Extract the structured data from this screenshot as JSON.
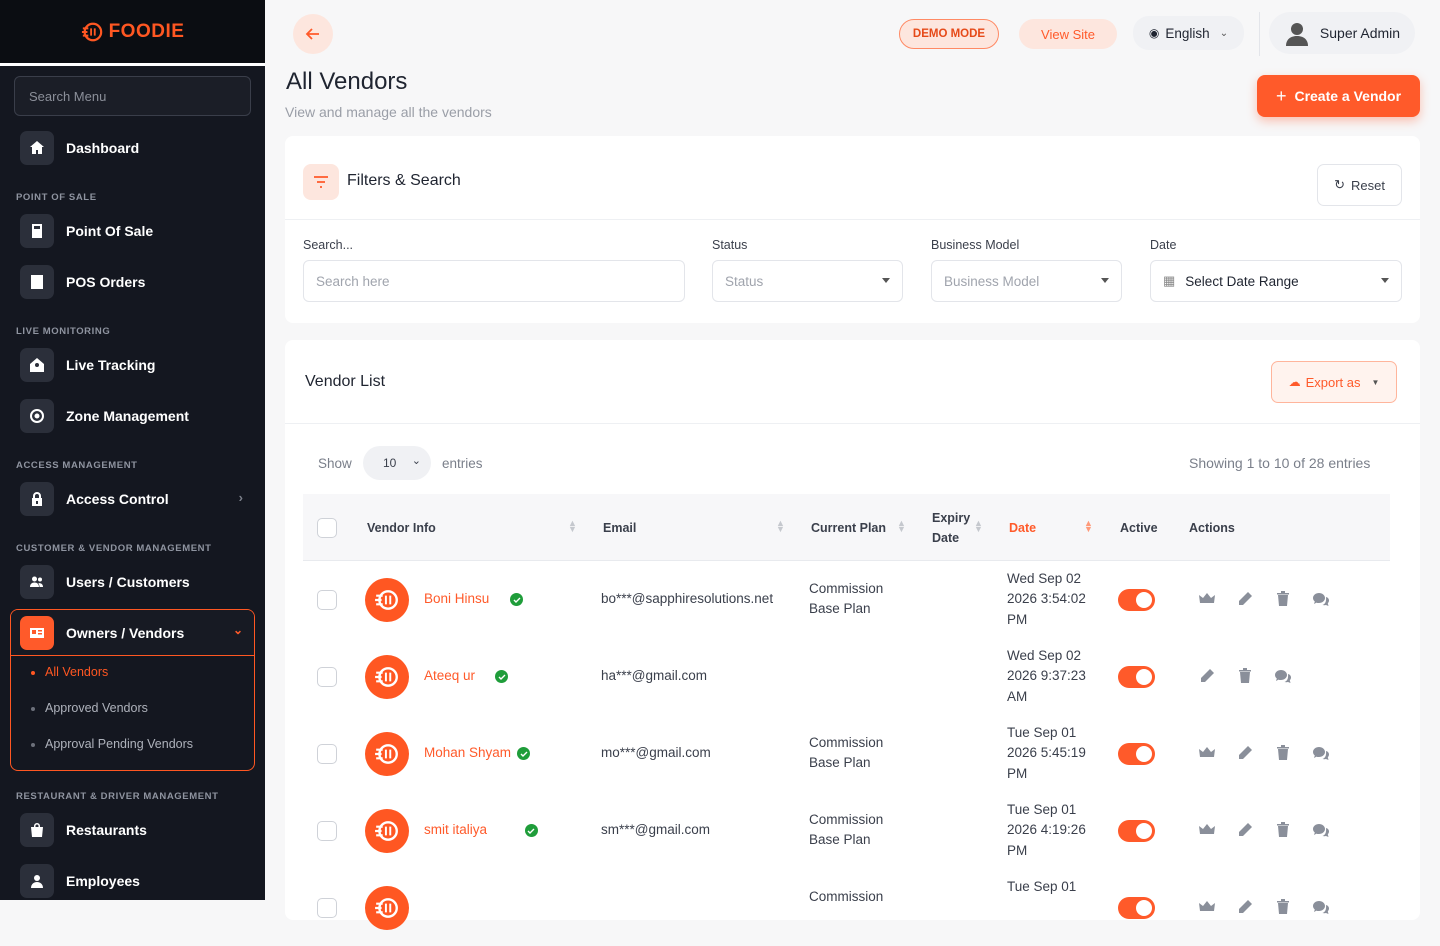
{
  "brand": {
    "name": "FOODIE",
    "accent": "#ff5722"
  },
  "sidebar": {
    "search_placeholder": "Search Menu",
    "dashboard": "Dashboard",
    "sections": {
      "pos": "POINT OF SALE",
      "live": "LIVE MONITORING",
      "access": "ACCESS MANAGEMENT",
      "customer_vendor": "CUSTOMER & VENDOR MANAGEMENT",
      "restaurant_driver": "RESTAURANT & DRIVER MANAGEMENT"
    },
    "items": {
      "point_of_sale": "Point Of Sale",
      "pos_orders": "POS Orders",
      "live_tracking": "Live Tracking",
      "zone_management": "Zone Management",
      "access_control": "Access Control",
      "users_customers": "Users / Customers",
      "owners_vendors": "Owners / Vendors",
      "restaurants": "Restaurants",
      "employees": "Employees"
    },
    "sub_items": {
      "all_vendors": "All Vendors",
      "approved_vendors": "Approved Vendors",
      "approval_pending": "Approval Pending Vendors"
    }
  },
  "topbar": {
    "demo_mode": "DEMO MODE",
    "view_site": "View Site",
    "language": "English",
    "user": "Super Admin"
  },
  "page": {
    "title": "All Vendors",
    "subtitle": "View and manage all the vendors",
    "create_button": "Create a Vendor"
  },
  "filters": {
    "title": "Filters & Search",
    "reset": "Reset",
    "search_label": "Search...",
    "search_placeholder": "Search here",
    "status_label": "Status",
    "status_placeholder": "Status",
    "business_label": "Business Model",
    "business_placeholder": "Business Model",
    "date_label": "Date",
    "date_value": "Select Date Range"
  },
  "list": {
    "title": "Vendor List",
    "export": "Export as",
    "show": "Show",
    "entries_value": "10",
    "entries": "entries",
    "showing": "Showing 1 to 10 of 28 entries",
    "columns": {
      "vendor": "Vendor Info",
      "email": "Email",
      "plan": "Current Plan",
      "expiry1": "Expiry",
      "expiry2": "Date",
      "date": "Date",
      "active": "Active",
      "actions": "Actions"
    },
    "rows": [
      {
        "name": "Boni Hinsu",
        "email": "bo***@sapphiresolutions.net",
        "plan1": "Commission",
        "plan2": "Base Plan",
        "d1": "Wed Sep 02",
        "d2": "2026 3:54:02",
        "d3": "PM",
        "crown": true
      },
      {
        "name": "Ateeq ur",
        "email": "ha***@gmail.com",
        "plan1": "",
        "plan2": "",
        "d1": "Wed Sep 02",
        "d2": "2026 9:37:23",
        "d3": "AM",
        "crown": false
      },
      {
        "name": "Mohan Shyam",
        "email": "mo***@gmail.com",
        "plan1": "Commission",
        "plan2": "Base Plan",
        "d1": "Tue Sep 01",
        "d2": "2026 5:45:19",
        "d3": "PM",
        "crown": true
      },
      {
        "name": "smit italiya",
        "email": "sm***@gmail.com",
        "plan1": "Commission",
        "plan2": "Base Plan",
        "d1": "Tue Sep 01",
        "d2": "2026 4:19:26",
        "d3": "PM",
        "crown": true
      },
      {
        "name": "",
        "email": "",
        "plan1": "Commission",
        "plan2": "",
        "d1": "Tue Sep 01",
        "d2": "",
        "d3": "",
        "crown": true
      }
    ]
  }
}
